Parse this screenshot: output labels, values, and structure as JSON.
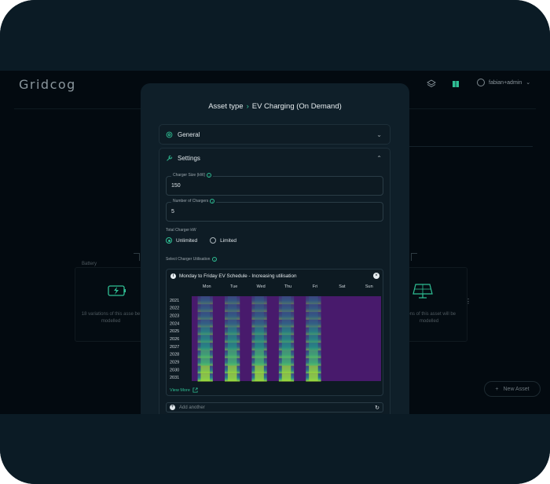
{
  "app": {
    "logo": "Gridcog",
    "user_name": "fabian+admin"
  },
  "background": {
    "battery_card_title": "Battery",
    "left_card_text": "18 variations of this asse be modelled",
    "right_card_text": "ations of this asset will be modelled",
    "new_asset_label": "New Asset"
  },
  "modal": {
    "breadcrumb_root": "Asset type",
    "breadcrumb_current": "EV Charging (On Demand)",
    "general": {
      "label": "General"
    },
    "settings": {
      "label": "Settings",
      "charger_size_label": "Charger Size (kW)",
      "charger_size_value": "150",
      "num_chargers_label": "Number of Chargers",
      "num_chargers_value": "5",
      "total_charger_label": "Total Charger kW",
      "radio_unlimited": "Unlimited",
      "radio_limited": "Limited",
      "selected_limit": "Unlimited",
      "utilisation_label": "Select Charger Utilisation"
    },
    "schedule": {
      "title": "Monday to Friday EV Schedule - Increasing utilisation",
      "view_more": "View More"
    },
    "add_another_placeholder": "Add another"
  },
  "chart_data": {
    "type": "heatmap",
    "x_categories": [
      "Mon",
      "Tue",
      "Wed",
      "Thu",
      "Fri",
      "Sat",
      "Sun"
    ],
    "y_categories": [
      "2021",
      "2022",
      "2023",
      "2024",
      "2025",
      "2026",
      "2027",
      "2028",
      "2029",
      "2030",
      "2031"
    ],
    "colormap": "viridis",
    "note_values": "relative utilisation 0-1; weekdays show daytime charging bands increasing by year, weekends zero",
    "daytime_intensity_by_year": [
      0.15,
      0.18,
      0.25,
      0.32,
      0.38,
      0.45,
      0.52,
      0.6,
      0.68,
      0.78,
      0.9
    ],
    "active_days": [
      1,
      1,
      1,
      1,
      1,
      0,
      0
    ]
  },
  "colors": {
    "accent": "#2fbf94",
    "modal_bg": "#0f1f29",
    "app_bg": "#030a10"
  }
}
